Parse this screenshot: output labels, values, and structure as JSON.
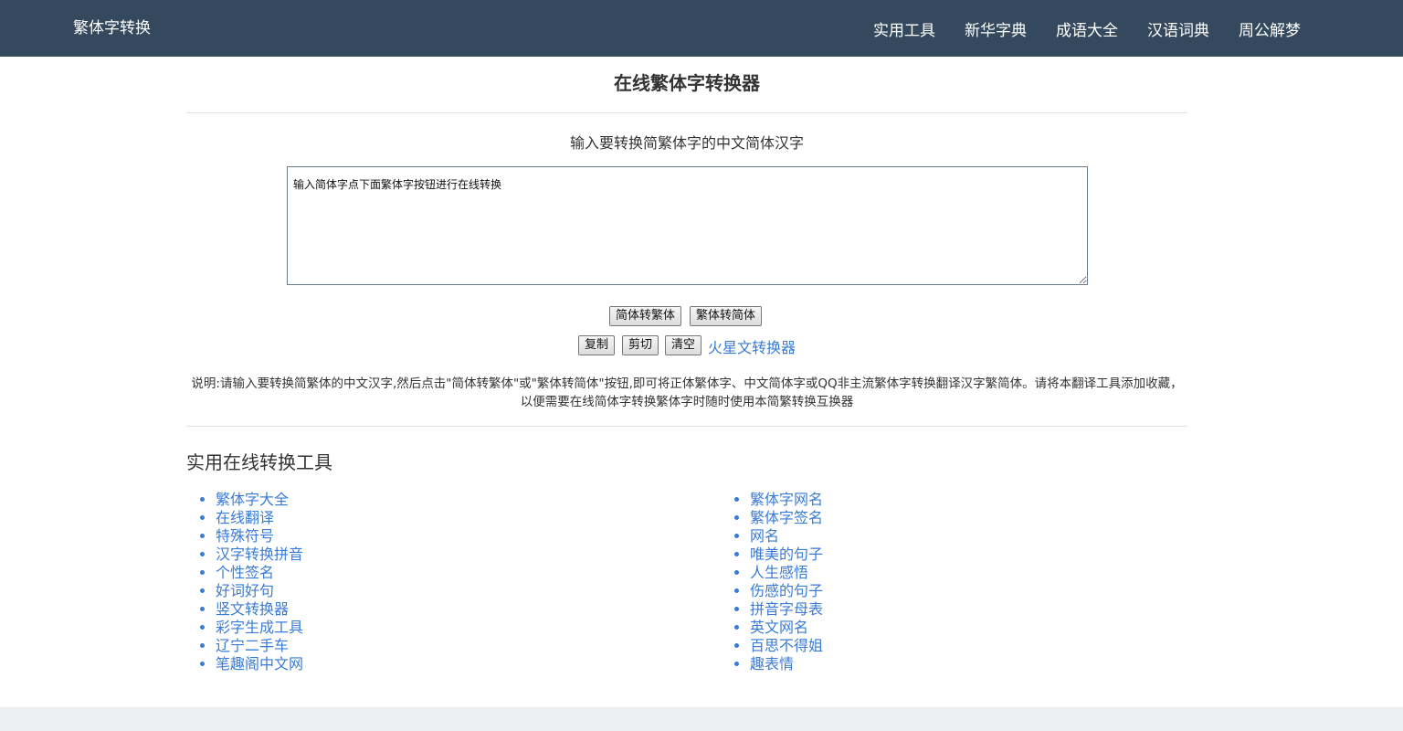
{
  "navbar": {
    "brand": "繁体字转换",
    "links": [
      "实用工具",
      "新华字典",
      "成语大全",
      "汉语词典",
      "周公解梦"
    ]
  },
  "main": {
    "title": "在线繁体字转换器",
    "input_label": "输入要转换简繁体字的中文简体汉字",
    "textarea_value": "输入简体字点下面繁体字按钮进行在线转换",
    "buttons": {
      "to_traditional": "简体转繁体",
      "to_simplified": "繁体转简体",
      "copy": "复制",
      "cut": "剪切",
      "clear": "清空"
    },
    "mars_link": "火星文转换器",
    "description": "说明:请输入要转换简繁体的中文汉字,然后点击\"简体转繁体\"或\"繁体转简体\"按钮,即可将正体繁体字、中文简体字或QQ非主流繁体字转换翻译汉字繁简体。请将本翻译工具添加收藏，以便需要在线简体字转换繁体字时随时使用本简繁转换互换器"
  },
  "tools": {
    "title": "实用在线转换工具",
    "left": [
      "繁体字大全",
      "在线翻译",
      "特殊符号",
      "汉字转换拼音",
      "个性签名",
      "好词好句",
      "竖文转换器",
      "彩字生成工具",
      "辽宁二手车",
      "笔趣阁中文网"
    ],
    "right": [
      "繁体字网名",
      "繁体字签名",
      "网名",
      "唯美的句子",
      "人生感悟",
      "伤感的句子",
      "拼音字母表",
      "英文网名",
      "百思不得姐",
      "趣表情"
    ]
  },
  "colors": {
    "navbar_bg": "#34495e",
    "link": "#3a7bd5",
    "footer_bg": "#ecf0f1"
  }
}
